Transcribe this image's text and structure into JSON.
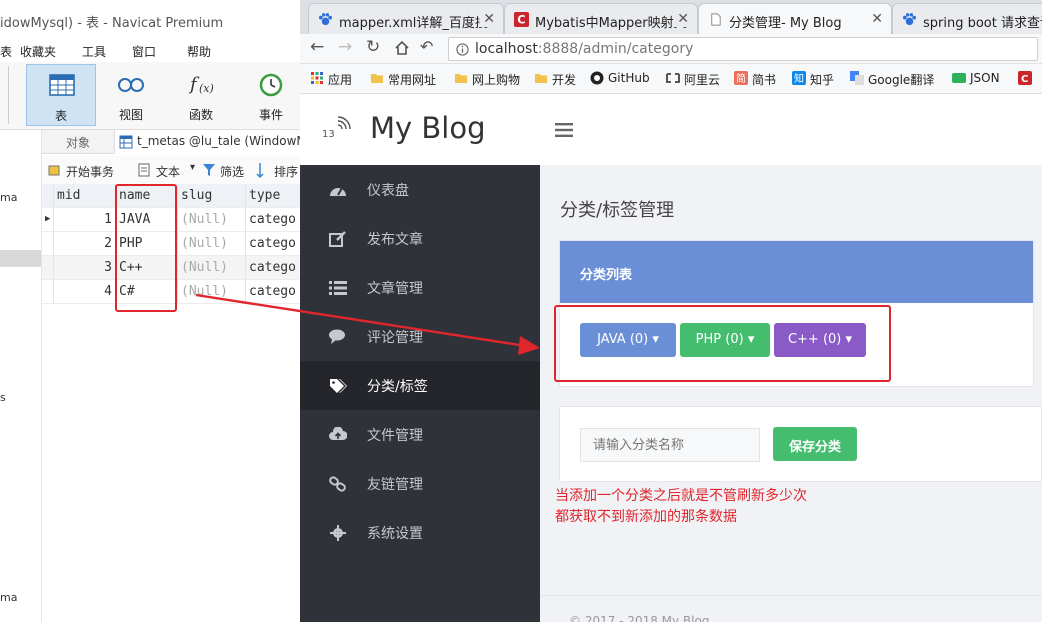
{
  "navicat": {
    "title": "idowMysql) - 表 - Navicat Premium",
    "menu": [
      "表",
      "收藏夹",
      "工具",
      "窗口",
      "帮助"
    ],
    "toolbar": [
      {
        "label": "表",
        "icon": "table-icon"
      },
      {
        "label": "视图",
        "icon": "view-icon"
      },
      {
        "label": "函数",
        "icon": "function-icon"
      },
      {
        "label": "事件",
        "icon": "clock-icon"
      }
    ],
    "left_panel_fragments": [
      "ma",
      "s",
      "ma"
    ],
    "tabs": {
      "objects": "对象",
      "table": "t_metas @lu_tale (WindowM"
    },
    "actions": {
      "begin": "开始事务",
      "text": "文本",
      "filter": "筛选",
      "sort": "排序"
    },
    "columns": [
      "mid",
      "name",
      "slug",
      "type"
    ],
    "rows": [
      {
        "mid": "1",
        "name": "JAVA",
        "slug": "(Null)",
        "type": "catego"
      },
      {
        "mid": "2",
        "name": "PHP",
        "slug": "(Null)",
        "type": "catego"
      },
      {
        "mid": "3",
        "name": "C++",
        "slug": "(Null)",
        "type": "catego"
      },
      {
        "mid": "4",
        "name": "C#",
        "slug": "(Null)",
        "type": "catego"
      }
    ]
  },
  "browser": {
    "tabs": [
      {
        "title": "mapper.xml详解_百度搜",
        "icon": "paw-icon"
      },
      {
        "title": "Mybatis中Mapper映射文",
        "icon": "c-brand-icon"
      },
      {
        "title": "分类管理- My Blog",
        "icon": "page-icon"
      },
      {
        "title": "spring boot 请求查询不",
        "icon": "paw-icon"
      }
    ],
    "url_host": "localhost",
    "url_rest": ":8888/admin/category",
    "bookmarks": [
      "应用",
      "常用网址",
      "网上购物",
      "开发",
      "GitHub",
      "阿里云",
      "简书",
      "知乎",
      "Google翻译",
      "JSON"
    ]
  },
  "blog": {
    "brand": "My Blog",
    "logo_num": "13",
    "nav": [
      "仪表盘",
      "发布文章",
      "文章管理",
      "评论管理",
      "分类/标签",
      "文件管理",
      "友链管理",
      "系统设置"
    ],
    "active_nav": 4,
    "page_title": "分类/标签管理",
    "list_title": "分类列表",
    "categories": [
      {
        "label": "JAVA (0)",
        "color": "#6b8fd6"
      },
      {
        "label": "PHP (0)",
        "color": "#45bd6f"
      },
      {
        "label": "C++ (0)",
        "color": "#8a5ac7"
      }
    ],
    "input_placeholder": "请输入分类名称",
    "save_label": "保存分类",
    "footer": "© 2017 - 2018 My Blog"
  },
  "annotation": {
    "line1": "当添加一个分类之后就是不管刷新多少次",
    "line2": "都获取不到新添加的那条数据",
    "color": "#e0262d"
  }
}
